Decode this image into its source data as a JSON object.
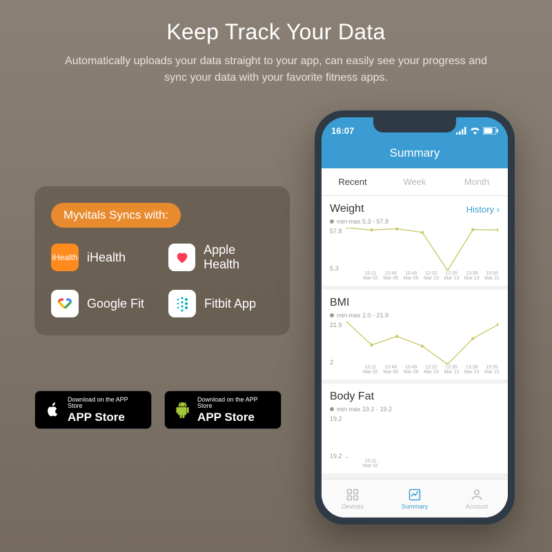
{
  "hero": {
    "title": "Keep Track Your Data",
    "subtitle": "Automatically uploads your data straight to your app, can easily see your progress and sync your data with your favorite fitness apps."
  },
  "syncs": {
    "pill": "Myvitals Syncs with:",
    "items": [
      {
        "label": "iHealth"
      },
      {
        "label": "Apple Health"
      },
      {
        "label": "Google Fit"
      },
      {
        "label": "Fitbit App"
      }
    ]
  },
  "download": {
    "small": "Download on the APP Store",
    "big": "APP Store"
  },
  "phone": {
    "time": "16:07",
    "appTitle": "Summary",
    "tabs": [
      "Recent",
      "Week",
      "Month"
    ],
    "history": "History",
    "nav": [
      "Devices",
      "Summary",
      "Account"
    ]
  },
  "chart_data": [
    {
      "type": "line",
      "title": "Weight",
      "minmax": "min-max 5.3 - 57.8",
      "ylim": [
        5.3,
        57.8
      ],
      "categories": [
        {
          "t": "15:11",
          "d": "Mar 02"
        },
        {
          "t": "10:48",
          "d": "Mar 06"
        },
        {
          "t": "10:49",
          "d": "Mar 06"
        },
        {
          "t": "12:32",
          "d": "Mar 13"
        },
        {
          "t": "12:35",
          "d": "Mar 13"
        },
        {
          "t": "13:39",
          "d": "Mar 13"
        },
        {
          "t": "15:55",
          "d": "Mar 21"
        }
      ],
      "values": [
        57.8,
        55.0,
        56.5,
        52.0,
        5.3,
        55.5,
        55.0
      ]
    },
    {
      "type": "line",
      "title": "BMI",
      "minmax": "min-max 2.0 - 21.9",
      "ylim": [
        2.0,
        21.9
      ],
      "categories": [
        {
          "t": "15:11",
          "d": "Mar 02"
        },
        {
          "t": "10:48",
          "d": "Mar 06"
        },
        {
          "t": "10:49",
          "d": "Mar 06"
        },
        {
          "t": "12:32",
          "d": "Mar 13"
        },
        {
          "t": "12:35",
          "d": "Mar 13"
        },
        {
          "t": "13:39",
          "d": "Mar 13"
        },
        {
          "t": "15:55",
          "d": "Mar 21"
        }
      ],
      "values": [
        21.9,
        11.0,
        15.0,
        10.5,
        2.0,
        14.0,
        20.5
      ]
    },
    {
      "type": "line",
      "title": "Body Fat",
      "minmax": "min-max 19.2 - 19.2",
      "ylim": [
        19.2,
        19.2
      ],
      "categories": [
        {
          "t": "15:11",
          "d": "Mar 02"
        }
      ],
      "values": [
        19.2
      ]
    }
  ]
}
